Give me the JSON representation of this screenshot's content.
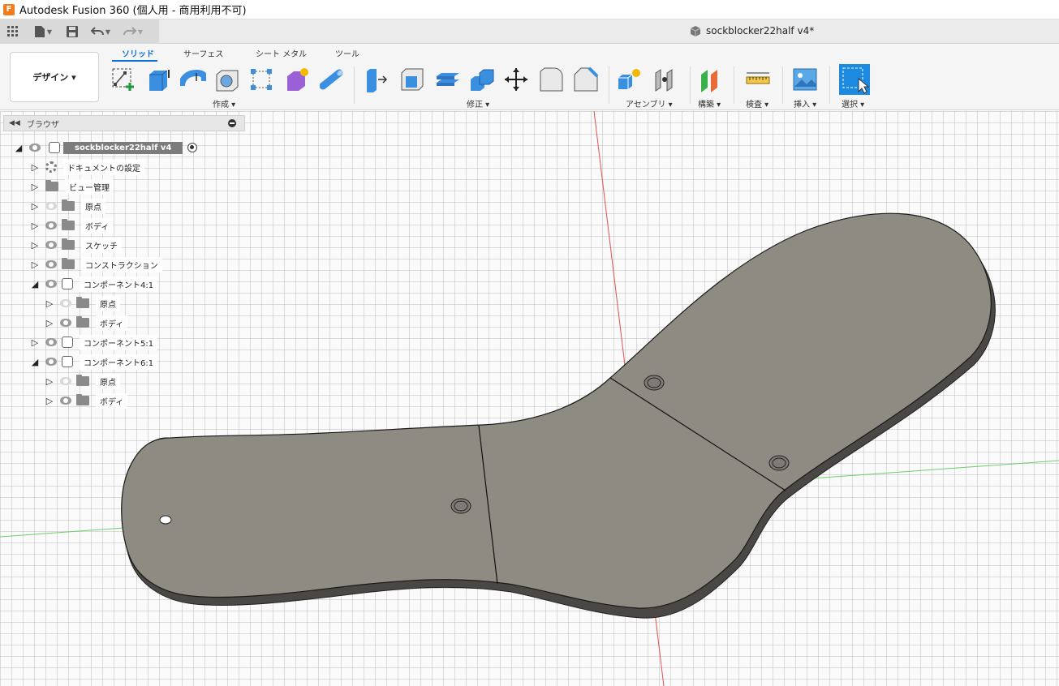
{
  "window": {
    "logo": "F",
    "title": "Autodesk Fusion 360 (個人用 - 商用利用不可)"
  },
  "document": {
    "tab_title": "sockblocker22half v4*"
  },
  "workspace": {
    "label": "デザイン ▾"
  },
  "tabs": [
    {
      "label": "ソリッド",
      "active": true
    },
    {
      "label": "サーフェス"
    },
    {
      "label": "シート メタル"
    },
    {
      "label": "ツール"
    }
  ],
  "groups": {
    "create": "作成 ▾",
    "modify": "修正 ▾",
    "assemble": "アセンブリ ▾",
    "construct": "構築 ▾",
    "inspect": "検査 ▾",
    "insert": "挿入 ▾",
    "select": "選択 ▾"
  },
  "browser": {
    "title": "ブラウザ",
    "root": "sockblocker22half v4",
    "items": [
      {
        "label": "ドキュメントの設定"
      },
      {
        "label": "ビュー管理"
      },
      {
        "label": "原点"
      },
      {
        "label": "ボディ"
      },
      {
        "label": "スケッチ"
      },
      {
        "label": "コンストラクション"
      },
      {
        "label": "コンポーネント4:1"
      },
      {
        "label": "原点"
      },
      {
        "label": "ボディ"
      },
      {
        "label": "コンポーネント5:1"
      },
      {
        "label": "コンポーネント6:1"
      },
      {
        "label": "原点"
      },
      {
        "label": "ボディ"
      }
    ]
  },
  "colors": {
    "accent": "#0a6fd6",
    "body_fill": "#8e8b83",
    "axis_red": "#e05050",
    "axis_green": "#6ccf6c"
  }
}
